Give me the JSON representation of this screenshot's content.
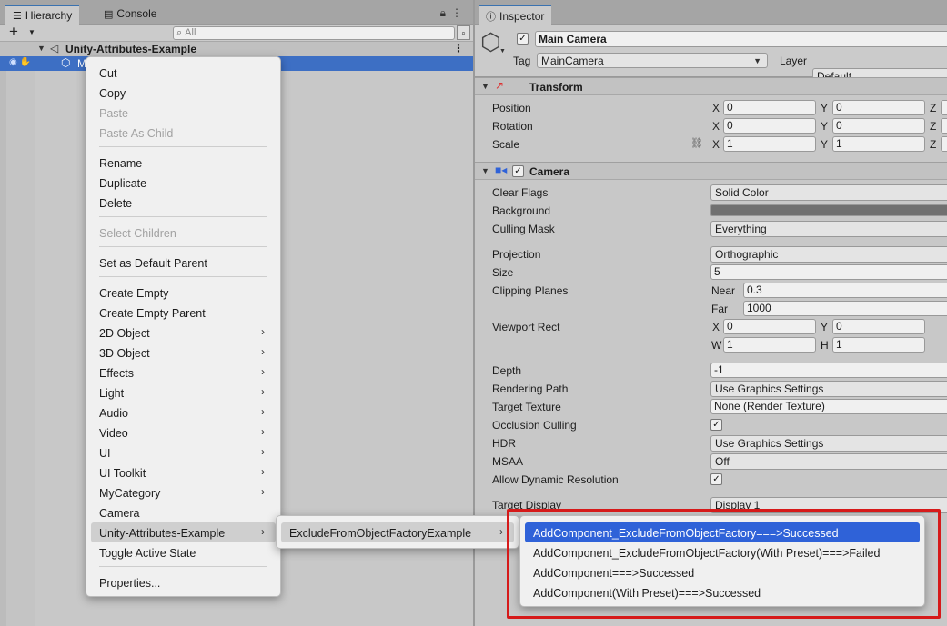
{
  "hierarchy": {
    "tab_label": "Hierarchy",
    "console_tab_label": "Console",
    "search_placeholder": "All",
    "scene_name": "Unity-Attributes-Example",
    "selected_object_label": "M"
  },
  "inspector": {
    "tab_label": "Inspector",
    "object_name": "Main Camera",
    "tag_label": "Tag",
    "tag_value": "MainCamera",
    "layer_label": "Layer",
    "layer_value": "Default",
    "transform": {
      "title": "Transform",
      "position_label": "Position",
      "rotation_label": "Rotation",
      "scale_label": "Scale",
      "axis_x": "X",
      "axis_y": "Y",
      "axis_z": "Z",
      "position": [
        "0",
        "0"
      ],
      "rotation": [
        "0",
        "0"
      ],
      "scale": [
        "1",
        "1"
      ]
    },
    "camera": {
      "title": "Camera",
      "clear_flags_label": "Clear Flags",
      "clear_flags_value": "Solid Color",
      "background_label": "Background",
      "culling_mask_label": "Culling Mask",
      "culling_mask_value": "Everything",
      "projection_label": "Projection",
      "projection_value": "Orthographic",
      "size_label": "Size",
      "size_value": "5",
      "clipping_label": "Clipping Planes",
      "near_label": "Near",
      "near_value": "0.3",
      "far_label": "Far",
      "far_value": "1000",
      "viewport_label": "Viewport Rect",
      "vp_x_label": "X",
      "vp_y_label": "Y",
      "vp_w_label": "W",
      "vp_h_label": "H",
      "vp_x": "0",
      "vp_y": "0",
      "vp_w": "1",
      "vp_h": "1",
      "depth_label": "Depth",
      "depth_value": "-1",
      "rendering_path_label": "Rendering Path",
      "rendering_path_value": "Use Graphics Settings",
      "target_texture_label": "Target Texture",
      "target_texture_value": "None (Render Texture)",
      "occlusion_label": "Occlusion Culling",
      "hdr_label": "HDR",
      "hdr_value": "Use Graphics Settings",
      "msaa_label": "MSAA",
      "msaa_value": "Off",
      "dynres_label": "Allow Dynamic Resolution",
      "target_display_label": "Target Display",
      "target_display_value": "Display 1"
    }
  },
  "context_menu": {
    "items": {
      "cut": "Cut",
      "copy": "Copy",
      "paste": "Paste",
      "paste_as_child": "Paste As Child",
      "rename": "Rename",
      "duplicate": "Duplicate",
      "delete": "Delete",
      "select_children": "Select Children",
      "set_default_parent": "Set as Default Parent",
      "create_empty": "Create Empty",
      "create_empty_parent": "Create Empty Parent",
      "object_2d": "2D Object",
      "object_3d": "3D Object",
      "effects": "Effects",
      "light": "Light",
      "audio": "Audio",
      "video": "Video",
      "ui": "UI",
      "ui_toolkit": "UI Toolkit",
      "my_category": "MyCategory",
      "camera": "Camera",
      "unity_attributes_example": "Unity-Attributes-Example",
      "toggle_active": "Toggle Active State",
      "properties": "Properties..."
    }
  },
  "submenu_1": {
    "item": "ExcludeFromObjectFactoryExample"
  },
  "submenu_2": {
    "items": [
      "AddComponent_ExcludeFromObjectFactory===>Successed",
      "AddComponent_ExcludeFromObjectFactory(With Preset)===>Failed",
      "AddComponent===>Successed",
      "AddComponent(With Preset)===>Successed"
    ]
  },
  "colors": {
    "selection_blue": "#2f62d8",
    "highlight_red": "#d61a1a",
    "background_color_swatch": "#707070"
  }
}
